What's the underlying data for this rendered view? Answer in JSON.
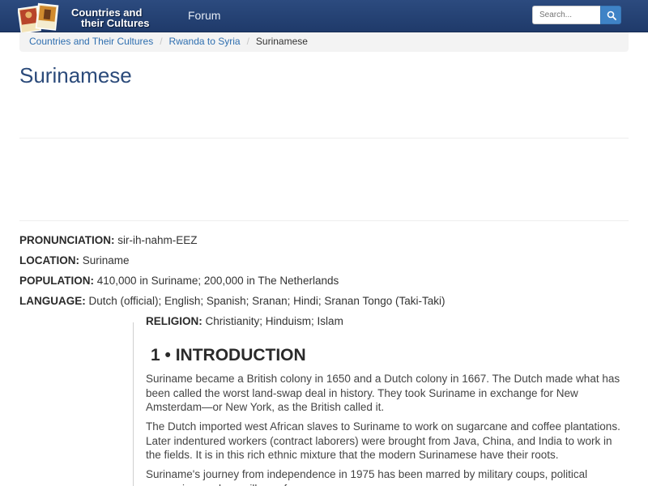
{
  "navbar": {
    "logo_line1": "Countries and",
    "logo_line2": "their Cultures",
    "forum_link": "Forum",
    "search_placeholder": "Search...",
    "search_icon": "search-icon"
  },
  "breadcrumb": {
    "items": [
      "Countries and Their Cultures",
      "Rwanda to Syria"
    ],
    "current": "Surinamese",
    "separator": "/"
  },
  "page": {
    "title": "Surinamese"
  },
  "facts": [
    {
      "label": "PRONUNCIATION:",
      "value": "sir-ih-nahm-EEZ"
    },
    {
      "label": "LOCATION:",
      "value": "Suriname"
    },
    {
      "label": "POPULATION:",
      "value": "410,000 in Suriname; 200,000 in The Netherlands"
    },
    {
      "label": "LANGUAGE:",
      "value": "Dutch (official); English; Spanish; Sranan; Hindi; Sranan Tongo (Taki-Taki)"
    },
    {
      "label": "RELIGION:",
      "value": "Christianity; Hinduism; Islam"
    }
  ],
  "section": {
    "heading": "1 • INTRODUCTION",
    "paragraphs": [
      "Suriname became a British colony in 1650 and a Dutch colony in 1667. The Dutch made what has been called the worst land-swap deal in history. They took Suriname in exchange for New Amsterdam—or New York, as the British called it.",
      "The Dutch imported west African slaves to Suriname to work on sugarcane and coffee plantations. Later indentured workers (contract laborers) were brought from Java, China, and India to work in the fields. It is in this rich ethnic mixture that the modern Surinamese have their roots.",
      "Suriname's journey from independence in 1975 has been marred by military coups, political repression, and guerrilla warfare."
    ]
  },
  "colors": {
    "navbar": "#1f3a6a",
    "link": "#2f6fb0",
    "title": "#2b4a7a",
    "search_button": "#3f83c6"
  }
}
